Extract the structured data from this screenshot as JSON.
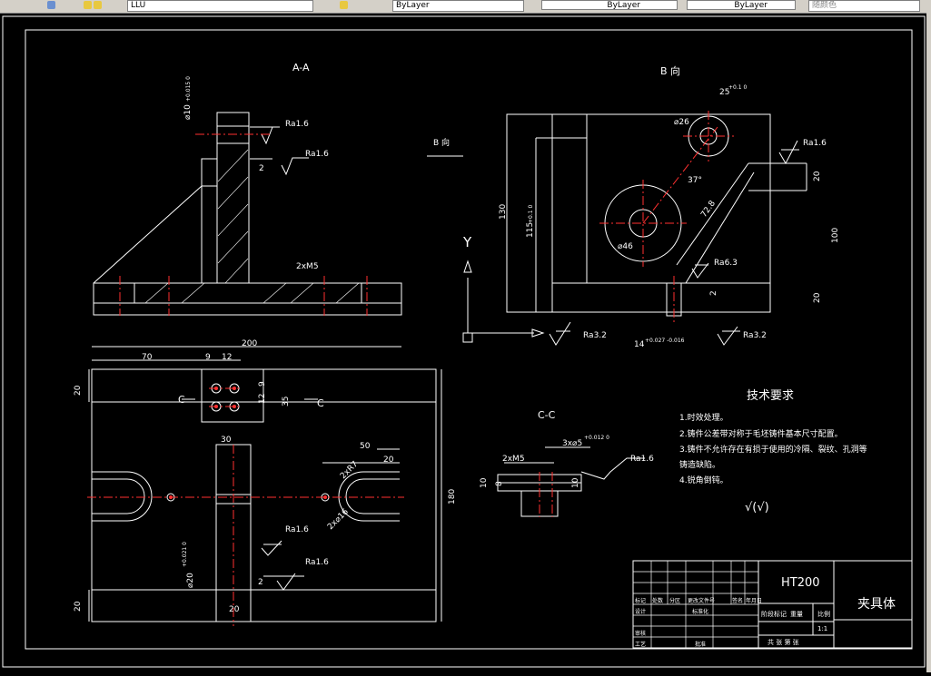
{
  "toolbar": {
    "layer_value": "LLU",
    "color_value": "ByLayer",
    "linetype_value": "ByLayer",
    "lineweight_value": "ByLayer",
    "plotstyle_value": "随颜色"
  },
  "colors": {
    "background": "#000000",
    "lines": "#ffffff",
    "centerline": "#ff3030",
    "toolbar": "#d4d0c8"
  },
  "views": {
    "section_aa_title": "A-A",
    "view_b_title": "B 向",
    "section_cc_title": "C-C",
    "view_b_arrow_label": "B 向",
    "section_marker_left": "C",
    "section_marker_right": "C"
  },
  "dimensions": {
    "aa_bore": "⌀10",
    "aa_bore_tol": "+0.015 0",
    "aa_ra_top": "Ra1.6",
    "aa_ra_mid": "Ra1.6",
    "aa_gap": "2",
    "aa_hole": "2xM5",
    "b_width_25": "25",
    "b_width_25_tol": "+0.1 0",
    "b_phi26": "⌀26",
    "b_angle": "37°",
    "b_diag": "72.8",
    "b_phi46": "⌀46",
    "b_ra_top": "Ra1.6",
    "b_ra_mid": "Ra6.3",
    "b_ra_bottom_left": "Ra3.2",
    "b_ra_bottom_right": "Ra3.2",
    "b_height_130": "130",
    "b_height_115": "115",
    "b_height_115_tol": "+0.1 0",
    "b_right_20_top": "20",
    "b_right_100": "100",
    "b_right_20_bottom": "20",
    "b_small_2": "2",
    "b_slot": "14",
    "b_slot_tol": "+0.027 -0.016",
    "axis_y": "Y",
    "top_200": "200",
    "top_70": "70",
    "top_9": "9",
    "top_12": "12",
    "side_20_top": "20",
    "side_9": "9",
    "side_12": "12",
    "side_35": "35",
    "mid_30": "30",
    "right_50": "50",
    "right_20": "20",
    "right_180": "180",
    "hole_r": "2xR7",
    "hole_d": "2x⌀16",
    "bot_bore": "⌀20",
    "bot_bore_tol": "+0.021 0",
    "bot_ra_1": "Ra1.6",
    "bot_ra_2": "Ra1.6",
    "bot_gap": "2",
    "bot_20": "20",
    "side_20_bottom": "20",
    "cc_hole": "2xM5",
    "cc_bore": "3x⌀5",
    "cc_bore_tol": "+0.012 0",
    "cc_ra": "Ra1.6",
    "cc_left_10": "10",
    "cc_left_8": "8",
    "cc_right_10": "10"
  },
  "tech_requirements": {
    "title": "技术要求",
    "items": [
      "1.时效处理。",
      "2.铸件公差带对称于毛坯铸件基本尺寸配置。",
      "3.铸件不允许存在有损于使用的冷隔、裂纹、孔洞等",
      "铸造缺陷。",
      "4.锐角倒钝。"
    ],
    "roughness_symbol": "√(√)"
  },
  "title_block": {
    "material": "HT200",
    "part_name": "夹具体",
    "scale": "1:1",
    "cells_row_labels": [
      "标记",
      "处数",
      "分区",
      "更改文件号",
      "签名",
      "年月日"
    ],
    "designer": "设计",
    "standardize": "标准化",
    "check": "审核",
    "process": "工艺",
    "approve": "批准",
    "stage": "阶段标记",
    "weight": "重量",
    "ratio": "比例",
    "sheets": "共 张 第 张"
  }
}
